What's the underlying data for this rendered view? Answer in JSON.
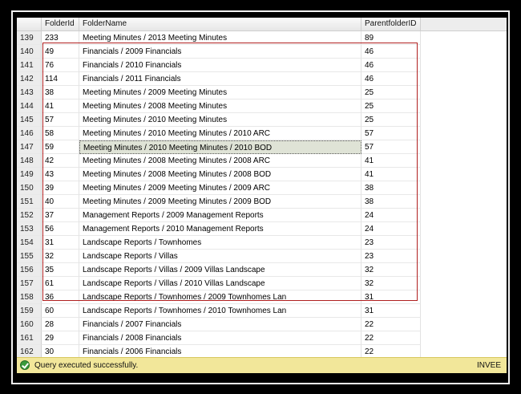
{
  "grid": {
    "columns": [
      "",
      "FolderId",
      "FolderName",
      "ParentfolderID"
    ],
    "rows": [
      {
        "num": "139",
        "folder_id": "233",
        "folder_name": "Meeting Minutes / 2013 Meeting Minutes",
        "parent_id": "89"
      },
      {
        "num": "140",
        "folder_id": "49",
        "folder_name": "Financials / 2009 Financials",
        "parent_id": "46"
      },
      {
        "num": "141",
        "folder_id": "76",
        "folder_name": "Financials / 2010 Financials",
        "parent_id": "46"
      },
      {
        "num": "142",
        "folder_id": "114",
        "folder_name": "Financials / 2011 Financials",
        "parent_id": "46"
      },
      {
        "num": "143",
        "folder_id": "38",
        "folder_name": "Meeting Minutes / 2009 Meeting Minutes",
        "parent_id": "25"
      },
      {
        "num": "144",
        "folder_id": "41",
        "folder_name": "Meeting Minutes / 2008 Meeting Minutes",
        "parent_id": "25"
      },
      {
        "num": "145",
        "folder_id": "57",
        "folder_name": "Meeting Minutes / 2010 Meeting Minutes",
        "parent_id": "25"
      },
      {
        "num": "146",
        "folder_id": "58",
        "folder_name": "Meeting Minutes / 2010 Meeting Minutes / 2010 ARC",
        "parent_id": "57"
      },
      {
        "num": "147",
        "folder_id": "59",
        "folder_name": "Meeting Minutes / 2010 Meeting Minutes / 2010 BOD",
        "parent_id": "57"
      },
      {
        "num": "148",
        "folder_id": "42",
        "folder_name": "Meeting Minutes / 2008 Meeting Minutes / 2008 ARC",
        "parent_id": "41"
      },
      {
        "num": "149",
        "folder_id": "43",
        "folder_name": "Meeting Minutes / 2008 Meeting Minutes / 2008 BOD",
        "parent_id": "41"
      },
      {
        "num": "150",
        "folder_id": "39",
        "folder_name": "Meeting Minutes / 2009 Meeting Minutes / 2009 ARC",
        "parent_id": "38"
      },
      {
        "num": "151",
        "folder_id": "40",
        "folder_name": "Meeting Minutes / 2009 Meeting Minutes / 2009 BOD",
        "parent_id": "38"
      },
      {
        "num": "152",
        "folder_id": "37",
        "folder_name": "Management Reports / 2009 Management Reports",
        "parent_id": "24"
      },
      {
        "num": "153",
        "folder_id": "56",
        "folder_name": "Management Reports / 2010 Management Reports",
        "parent_id": "24"
      },
      {
        "num": "154",
        "folder_id": "31",
        "folder_name": "Landscape Reports / Townhomes",
        "parent_id": "23"
      },
      {
        "num": "155",
        "folder_id": "32",
        "folder_name": "Landscape Reports / Villas",
        "parent_id": "23"
      },
      {
        "num": "156",
        "folder_id": "35",
        "folder_name": "Landscape Reports / Villas / 2009 Villas Landscape",
        "parent_id": "32"
      },
      {
        "num": "157",
        "folder_id": "61",
        "folder_name": "Landscape Reports / Villas / 2010 Villas Landscape",
        "parent_id": "32"
      },
      {
        "num": "158",
        "folder_id": "36",
        "folder_name": "Landscape Reports / Townhomes / 2009 Townhomes Lan",
        "parent_id": "31"
      },
      {
        "num": "159",
        "folder_id": "60",
        "folder_name": "Landscape Reports / Townhomes / 2010 Townhomes Lan",
        "parent_id": "31"
      },
      {
        "num": "160",
        "folder_id": "28",
        "folder_name": "Financials / 2007 Financials",
        "parent_id": "22"
      },
      {
        "num": "161",
        "folder_id": "29",
        "folder_name": "Financials / 2008 Financials",
        "parent_id": "22"
      },
      {
        "num": "162",
        "folder_id": "30",
        "folder_name": "Financials / 2006 Financials",
        "parent_id": "22"
      }
    ],
    "selected_row": "147"
  },
  "status": {
    "message": "Query executed successfully.",
    "server": "INVEE",
    "icon": "success-check-icon",
    "bar_color": "#f2e79a"
  },
  "annotation": {
    "color": "#b02020"
  }
}
